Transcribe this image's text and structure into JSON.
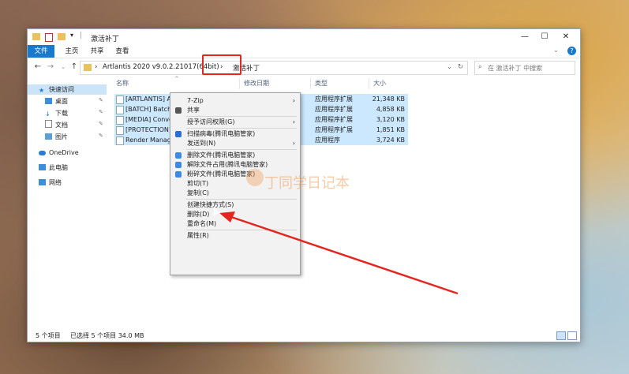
{
  "window": {
    "title": "激活补丁",
    "controls": {
      "minimize": "—",
      "maximize": "☐",
      "close": "✕"
    }
  },
  "ribbon": {
    "tabs": [
      "文件",
      "主页",
      "共享",
      "查看"
    ],
    "help": "?"
  },
  "address": {
    "crumbs": [
      "›",
      "Artlantis 2020 v9.0.2.21017(64bit)",
      "›",
      "激活补丁"
    ],
    "dropdown": "⌄",
    "refresh": "↻",
    "search_placeholder": "在 激活补丁 中搜索"
  },
  "nav": {
    "quick_access": "快速访问",
    "items": [
      {
        "label": "桌面",
        "pinned": true
      },
      {
        "label": "下载",
        "pinned": true
      },
      {
        "label": "文档",
        "pinned": true
      },
      {
        "label": "图片",
        "pinned": true
      }
    ],
    "onedrive": "OneDrive",
    "this_pc": "此电脑",
    "network": "网络",
    "pin_glyph": "📌"
  },
  "columns": {
    "name": "名称",
    "modified": "修改日期",
    "type": "类型",
    "size": "大小",
    "sort_arrow": "^"
  },
  "files": [
    {
      "name": "[ARTLANTIS] All",
      "type": "应用程序扩展",
      "size": "21,348 KB"
    },
    {
      "name": "[BATCH] BatchW",
      "type": "应用程序扩展",
      "size": "4,858 KB"
    },
    {
      "name": "[MEDIA] Conve",
      "type": "应用程序扩展",
      "size": "3,120 KB"
    },
    {
      "name": "[PROTECTION]",
      "type": "应用程序扩展",
      "size": "1,851 KB"
    },
    {
      "name": "Render Manag",
      "type": "应用程序",
      "size": "3,724 KB"
    }
  ],
  "context_menu": {
    "items": [
      {
        "label": "7-Zip",
        "submenu": true,
        "icon": ""
      },
      {
        "label": "共享",
        "submenu": false,
        "icon": "share-icon"
      },
      {
        "sep": true
      },
      {
        "label": "授予访问权限(G)",
        "submenu": true,
        "icon": ""
      },
      {
        "sep": true
      },
      {
        "label": "扫描病毒(腾讯电脑管家)",
        "submenu": false,
        "icon": "shield-icon"
      },
      {
        "label": "发送到(N)",
        "submenu": true,
        "icon": ""
      },
      {
        "sep": true
      },
      {
        "label": "删除文件(腾讯电脑管家)",
        "submenu": false,
        "icon": "delete-icon"
      },
      {
        "label": "解除文件占用(腾讯电脑管家)",
        "submenu": false,
        "icon": "unlock-icon"
      },
      {
        "label": "粉碎文件(腾讯电脑管家)",
        "submenu": false,
        "icon": "shred-icon"
      },
      {
        "label": "剪切(T)",
        "submenu": false,
        "icon": ""
      },
      {
        "label": "复制(C)",
        "submenu": false,
        "icon": ""
      },
      {
        "sep": true
      },
      {
        "label": "创建快捷方式(S)",
        "submenu": false,
        "icon": ""
      },
      {
        "label": "删除(D)",
        "submenu": false,
        "icon": ""
      },
      {
        "label": "重命名(M)",
        "submenu": false,
        "icon": ""
      },
      {
        "sep": true
      },
      {
        "label": "属性(R)",
        "submenu": false,
        "icon": ""
      }
    ],
    "arrow_glyph": "›"
  },
  "status": {
    "count": "5 个项目",
    "selected": "已选择 5 个项目  34.0 MB"
  },
  "watermark": "丁同学日记本",
  "colors": {
    "accent": "#1979ca",
    "selection": "#cce8ff",
    "annotation": "#e3261f"
  }
}
